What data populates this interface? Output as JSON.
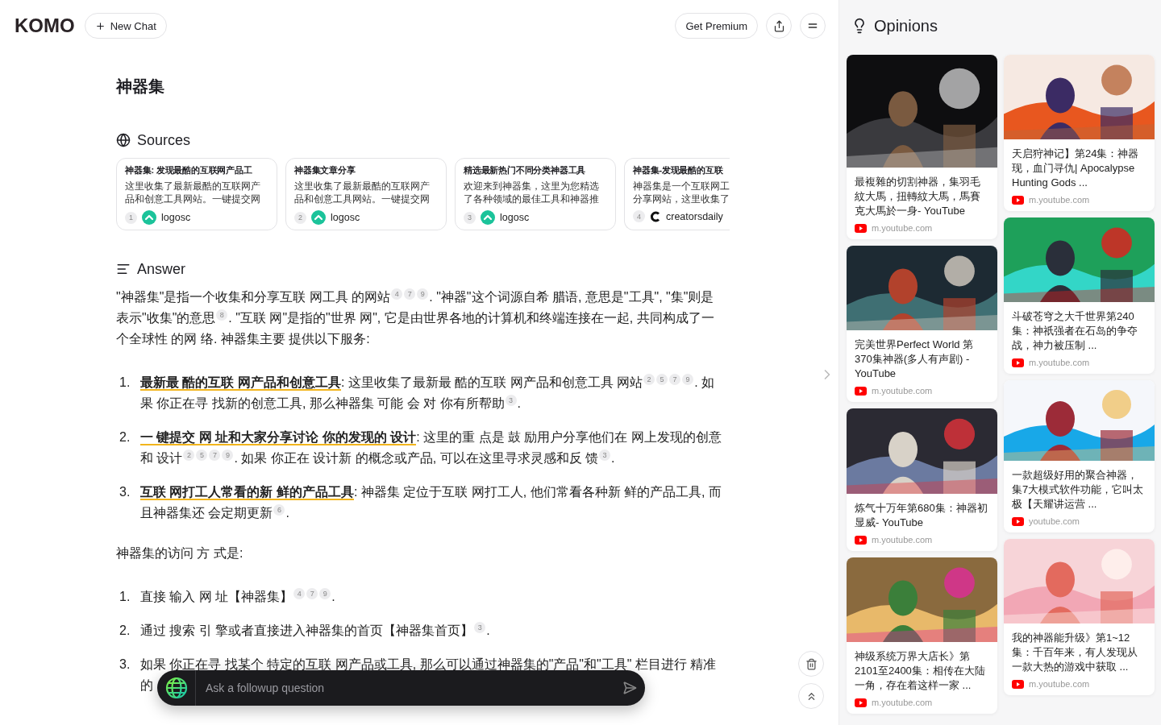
{
  "header": {
    "logo": "KOMO",
    "new_chat": "New Chat",
    "premium": "Get Premium"
  },
  "title": "神器集",
  "sources": {
    "heading": "Sources",
    "items": [
      {
        "title": "神器集: 发现最酷的互联网产品工",
        "snippet": "这里收集了最新最酷的互联网产品和创意工具网站。一键提交网",
        "index": "1",
        "site": "logosc",
        "kind": "chevron"
      },
      {
        "title": "神器集文章分享",
        "snippet": "这里收集了最新最酷的互联网产品和创意工具网站。一键提交网",
        "index": "2",
        "site": "logosc",
        "kind": "chevron"
      },
      {
        "title": "精选最新热门不同分类神器工具",
        "snippet": "欢迎来到神器集，这里为您精选了各种领域的最佳工具和神器推",
        "index": "3",
        "site": "logosc",
        "kind": "chevron"
      },
      {
        "title": "神器集-发现最酷的互联",
        "snippet": "神器集是一个互联网工分享网站，这里收集了",
        "index": "4",
        "site": "creatorsdaily",
        "kind": "letter"
      }
    ]
  },
  "answer": {
    "heading": "Answer",
    "blocks": [
      {
        "kind": "paragraph",
        "segments": [
          {
            "text": "\"神器集\"是指一个收集和分享互联 网工具 的网站",
            "cites": [
              "4",
              "7",
              "9"
            ]
          },
          {
            "text": ". \"神器\"这个词源自希 腊语, 意思是\"工具\", \"集\"则是表示\"收集\"的意思",
            "cites": [
              "8"
            ]
          },
          {
            "text": ". \"互联 网\"是指的\"世界 网\", 它是由世界各地的计算机和终端连接在一起, 共同构成了一个全球性 的网 络. 神器集主要 提供以下服务:"
          }
        ]
      },
      {
        "kind": "list",
        "items": [
          {
            "number": "1.",
            "title": "最新最 酷的互联 网产品和创意工具",
            "segments": [
              {
                "text": ": 这里收集了最新最 酷的互联 网产品和创意工具 网站",
                "cites": [
                  "2",
                  "5",
                  "7",
                  "9"
                ]
              },
              {
                "text": ". 如果 你正在寻 找新的创意工具, 那么神器集 可能 会 对 你有所帮助",
                "cites": [
                  "3"
                ]
              },
              {
                "text": "."
              }
            ]
          },
          {
            "number": "2.",
            "title": "一 键提交 网 址和大家分享讨论 你的发现的 设计",
            "segments": [
              {
                "text": ": 这里的重 点是 鼓 励用户分享他们在 网上发现的创意和 设计",
                "cites": [
                  "2",
                  "5",
                  "7",
                  "9"
                ]
              },
              {
                "text": ". 如果 你正在 设计新 的概念或产品, 可以在这里寻求灵感和反 馈",
                "cites": [
                  "3"
                ]
              },
              {
                "text": "."
              }
            ]
          },
          {
            "number": "3.",
            "title": "互联 网打工人常看的新 鲜的产品工具",
            "segments": [
              {
                "text": ": 神器集 定位于互联 网打工人, 他们常看各种新 鲜的产品工具, 而且神器集还 会定期更新",
                "cites": [
                  "6"
                ]
              },
              {
                "text": "."
              }
            ]
          }
        ]
      },
      {
        "kind": "paragraph",
        "segments": [
          {
            "text": "神器集的访问 方 式是:"
          }
        ]
      },
      {
        "kind": "list",
        "items": [
          {
            "number": "1.",
            "segments": [
              {
                "text": "直接 输入 网 址【神器集】",
                "cites": [
                  "4",
                  "7",
                  "9"
                ]
              },
              {
                "text": "."
              }
            ]
          },
          {
            "number": "2.",
            "segments": [
              {
                "text": "通过 搜索 引 擎或者直接进入神器集的首页【神器集首页】",
                "cites": [
                  "3"
                ]
              },
              {
                "text": "."
              }
            ]
          },
          {
            "number": "3.",
            "lines": [
              "如果 你正在寻 找某个 特定的互联 网产品或工具, 那么可以通过神器集的\"产品\"和\"工具\" 栏目进行 精准",
              "的"
            ]
          }
        ]
      }
    ]
  },
  "followup": {
    "placeholder": "Ask a followup question"
  },
  "opinions": {
    "heading": "Opinions",
    "columns": [
      [
        {
          "title": "最複雜的切割神器，集羽毛紋大馬，扭轉紋大馬，馬賽克大馬於一身- YouTube",
          "site": "m.youtube.com"
        },
        {
          "title": "完美世界Perfect World 第370集神器(多人有声剧) - YouTube",
          "site": "m.youtube.com"
        },
        {
          "title": "炼气十万年第680集：神器初显威- YouTube",
          "site": "m.youtube.com"
        },
        {
          "title": "神级系统万界大店长》第2101至2400集：相传在大陆一角，存在着这样一家 ...",
          "site": "m.youtube.com"
        }
      ],
      [
        {
          "title": "天启狩神记】第24集：神器现，血门寻仇| Apocalypse Hunting Gods ...",
          "site": "m.youtube.com"
        },
        {
          "title": "斗破苍穹之大千世界第240集：神祇强者在石岛的争夺战，神力被压制 ...",
          "site": "m.youtube.com"
        },
        {
          "title": "一款超级好用的聚合神器，集7大模式软件功能，它叫太极【天耀讲运营 ...",
          "site": "youtube.com"
        },
        {
          "title": "我的神器能升级》第1~12集：千百年来，有人发现从一款大热的游戏中获取 ...",
          "site": "m.youtube.com"
        }
      ]
    ]
  }
}
